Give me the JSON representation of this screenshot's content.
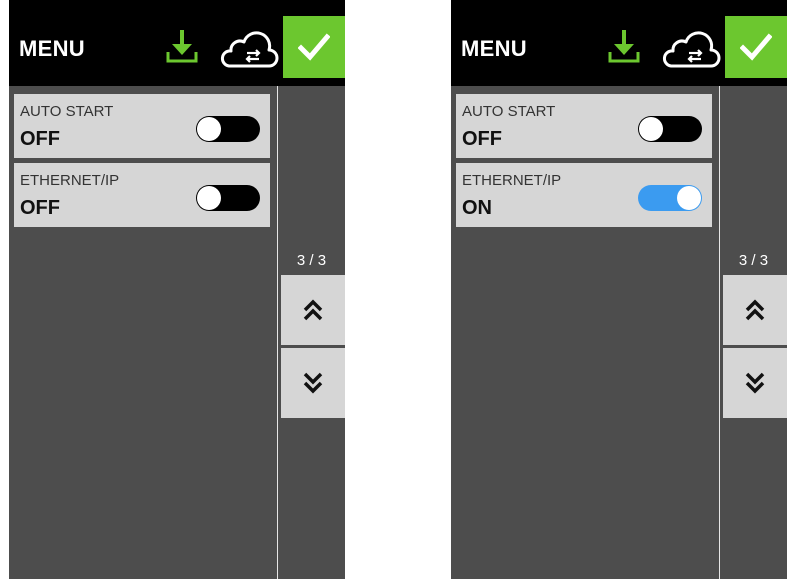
{
  "colors": {
    "accent_green": "#6cc72f",
    "toggle_on": "#3b9bf0",
    "toggle_off": "#000000",
    "panel_bg": "#4d4d4d",
    "item_bg": "#d6d6d6"
  },
  "screens": [
    {
      "header": {
        "title": "MENU",
        "icons": [
          "download-icon",
          "cloud-sync-icon",
          "checkmark-icon"
        ]
      },
      "settings": [
        {
          "label": "AUTO START",
          "value": "OFF",
          "toggle_on": false
        },
        {
          "label": "ETHERNET/IP",
          "value": "OFF",
          "toggle_on": false
        }
      ],
      "pager": {
        "indicator": "3 / 3",
        "icons": [
          "double-chevron-up-icon",
          "double-chevron-down-icon"
        ]
      }
    },
    {
      "header": {
        "title": "MENU",
        "icons": [
          "download-icon",
          "cloud-sync-icon",
          "checkmark-icon"
        ]
      },
      "settings": [
        {
          "label": "AUTO START",
          "value": "OFF",
          "toggle_on": false
        },
        {
          "label": "ETHERNET/IP",
          "value": "ON",
          "toggle_on": true
        }
      ],
      "pager": {
        "indicator": "3 / 3",
        "icons": [
          "double-chevron-up-icon",
          "double-chevron-down-icon"
        ]
      }
    }
  ]
}
